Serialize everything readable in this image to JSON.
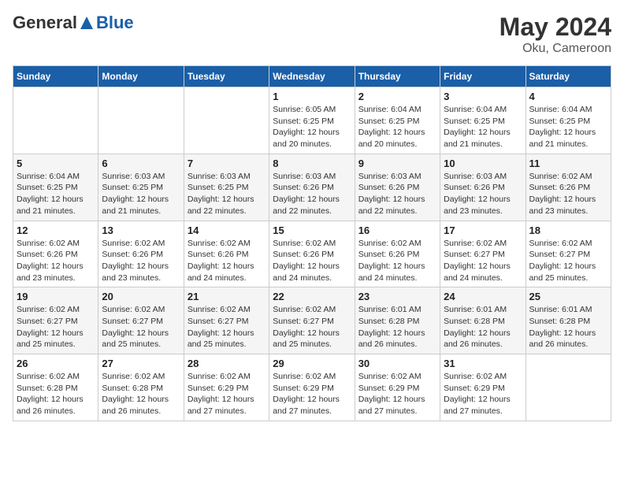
{
  "header": {
    "logo": {
      "general": "General",
      "blue": "Blue"
    },
    "title": "May 2024",
    "location": "Oku, Cameroon"
  },
  "calendar": {
    "weekdays": [
      "Sunday",
      "Monday",
      "Tuesday",
      "Wednesday",
      "Thursday",
      "Friday",
      "Saturday"
    ],
    "weeks": [
      [
        {
          "day": "",
          "info": ""
        },
        {
          "day": "",
          "info": ""
        },
        {
          "day": "",
          "info": ""
        },
        {
          "day": "1",
          "info": "Sunrise: 6:05 AM\nSunset: 6:25 PM\nDaylight: 12 hours\nand 20 minutes."
        },
        {
          "day": "2",
          "info": "Sunrise: 6:04 AM\nSunset: 6:25 PM\nDaylight: 12 hours\nand 20 minutes."
        },
        {
          "day": "3",
          "info": "Sunrise: 6:04 AM\nSunset: 6:25 PM\nDaylight: 12 hours\nand 21 minutes."
        },
        {
          "day": "4",
          "info": "Sunrise: 6:04 AM\nSunset: 6:25 PM\nDaylight: 12 hours\nand 21 minutes."
        }
      ],
      [
        {
          "day": "5",
          "info": "Sunrise: 6:04 AM\nSunset: 6:25 PM\nDaylight: 12 hours\nand 21 minutes."
        },
        {
          "day": "6",
          "info": "Sunrise: 6:03 AM\nSunset: 6:25 PM\nDaylight: 12 hours\nand 21 minutes."
        },
        {
          "day": "7",
          "info": "Sunrise: 6:03 AM\nSunset: 6:25 PM\nDaylight: 12 hours\nand 22 minutes."
        },
        {
          "day": "8",
          "info": "Sunrise: 6:03 AM\nSunset: 6:26 PM\nDaylight: 12 hours\nand 22 minutes."
        },
        {
          "day": "9",
          "info": "Sunrise: 6:03 AM\nSunset: 6:26 PM\nDaylight: 12 hours\nand 22 minutes."
        },
        {
          "day": "10",
          "info": "Sunrise: 6:03 AM\nSunset: 6:26 PM\nDaylight: 12 hours\nand 23 minutes."
        },
        {
          "day": "11",
          "info": "Sunrise: 6:02 AM\nSunset: 6:26 PM\nDaylight: 12 hours\nand 23 minutes."
        }
      ],
      [
        {
          "day": "12",
          "info": "Sunrise: 6:02 AM\nSunset: 6:26 PM\nDaylight: 12 hours\nand 23 minutes."
        },
        {
          "day": "13",
          "info": "Sunrise: 6:02 AM\nSunset: 6:26 PM\nDaylight: 12 hours\nand 23 minutes."
        },
        {
          "day": "14",
          "info": "Sunrise: 6:02 AM\nSunset: 6:26 PM\nDaylight: 12 hours\nand 24 minutes."
        },
        {
          "day": "15",
          "info": "Sunrise: 6:02 AM\nSunset: 6:26 PM\nDaylight: 12 hours\nand 24 minutes."
        },
        {
          "day": "16",
          "info": "Sunrise: 6:02 AM\nSunset: 6:26 PM\nDaylight: 12 hours\nand 24 minutes."
        },
        {
          "day": "17",
          "info": "Sunrise: 6:02 AM\nSunset: 6:27 PM\nDaylight: 12 hours\nand 24 minutes."
        },
        {
          "day": "18",
          "info": "Sunrise: 6:02 AM\nSunset: 6:27 PM\nDaylight: 12 hours\nand 25 minutes."
        }
      ],
      [
        {
          "day": "19",
          "info": "Sunrise: 6:02 AM\nSunset: 6:27 PM\nDaylight: 12 hours\nand 25 minutes."
        },
        {
          "day": "20",
          "info": "Sunrise: 6:02 AM\nSunset: 6:27 PM\nDaylight: 12 hours\nand 25 minutes."
        },
        {
          "day": "21",
          "info": "Sunrise: 6:02 AM\nSunset: 6:27 PM\nDaylight: 12 hours\nand 25 minutes."
        },
        {
          "day": "22",
          "info": "Sunrise: 6:02 AM\nSunset: 6:27 PM\nDaylight: 12 hours\nand 25 minutes."
        },
        {
          "day": "23",
          "info": "Sunrise: 6:01 AM\nSunset: 6:28 PM\nDaylight: 12 hours\nand 26 minutes."
        },
        {
          "day": "24",
          "info": "Sunrise: 6:01 AM\nSunset: 6:28 PM\nDaylight: 12 hours\nand 26 minutes."
        },
        {
          "day": "25",
          "info": "Sunrise: 6:01 AM\nSunset: 6:28 PM\nDaylight: 12 hours\nand 26 minutes."
        }
      ],
      [
        {
          "day": "26",
          "info": "Sunrise: 6:02 AM\nSunset: 6:28 PM\nDaylight: 12 hours\nand 26 minutes."
        },
        {
          "day": "27",
          "info": "Sunrise: 6:02 AM\nSunset: 6:28 PM\nDaylight: 12 hours\nand 26 minutes."
        },
        {
          "day": "28",
          "info": "Sunrise: 6:02 AM\nSunset: 6:29 PM\nDaylight: 12 hours\nand 27 minutes."
        },
        {
          "day": "29",
          "info": "Sunrise: 6:02 AM\nSunset: 6:29 PM\nDaylight: 12 hours\nand 27 minutes."
        },
        {
          "day": "30",
          "info": "Sunrise: 6:02 AM\nSunset: 6:29 PM\nDaylight: 12 hours\nand 27 minutes."
        },
        {
          "day": "31",
          "info": "Sunrise: 6:02 AM\nSunset: 6:29 PM\nDaylight: 12 hours\nand 27 minutes."
        },
        {
          "day": "",
          "info": ""
        }
      ]
    ]
  }
}
